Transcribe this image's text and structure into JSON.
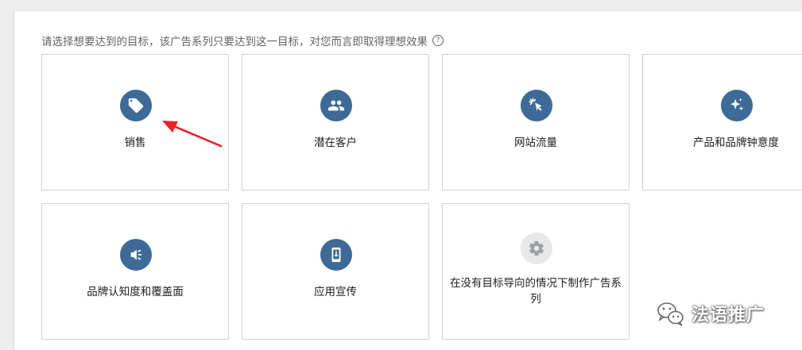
{
  "instruction": "请选择想要达到的目标，该广告系列只要达到这一目标，对您而言即取得理想效果",
  "help_icon_glyph": "?",
  "goals": [
    {
      "label": "销售",
      "icon": "tag-icon"
    },
    {
      "label": "潜在客户",
      "icon": "people-icon"
    },
    {
      "label": "网站流量",
      "icon": "cursor-click-icon"
    },
    {
      "label": "产品和品牌钟意度",
      "icon": "sparkle-icon"
    },
    {
      "label": "品牌认知度和覆盖面",
      "icon": "megaphone-icon"
    },
    {
      "label": "应用宣传",
      "icon": "phone-download-icon"
    },
    {
      "label": "在没有目标导向的情况下制作广告系列",
      "icon": "gear-icon"
    }
  ],
  "watermark": "法语推广",
  "colors": {
    "accent": "#3d6a96",
    "arrow": "#e8242a",
    "border": "#cfd3d7"
  }
}
